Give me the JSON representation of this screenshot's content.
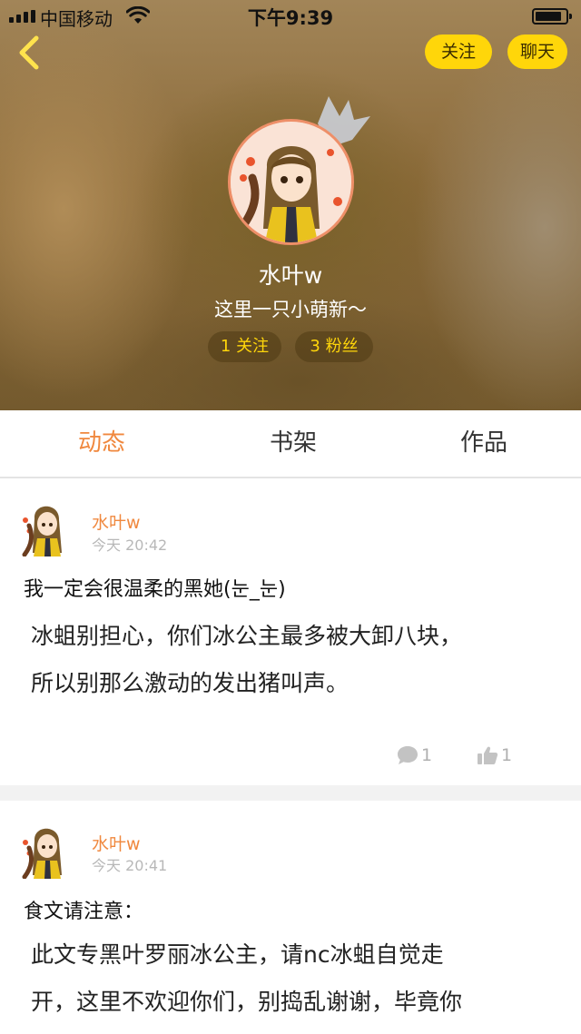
{
  "status_bar": {
    "carrier": "中国移动",
    "time": "下午9:39"
  },
  "header": {
    "follow_label": "关注",
    "chat_label": "聊天",
    "name": "水叶w",
    "bio": "这里一只小萌新～",
    "following_count": "1 关注",
    "fans_count": "3 粉丝"
  },
  "tabs": [
    {
      "label": "动态",
      "active": true
    },
    {
      "label": "书架",
      "active": false
    },
    {
      "label": "作品",
      "active": false
    }
  ],
  "posts": [
    {
      "author": "水叶w",
      "time": "今天 20:42",
      "title": "我一定会很温柔的黑她(눈_눈)",
      "body_lines": [
        "冰蛆别担心，你们冰公主最多被大卸八块，",
        "所以别那么激动的发出猪叫声。"
      ],
      "comments": "1",
      "likes": "1"
    },
    {
      "author": "水叶w",
      "time": "今天 20:41",
      "title": "食文请注意：",
      "body_lines": [
        "此文专黑叶罗丽冰公主，请nc冰蛆自觉走",
        "开，这里不欢迎你们，别捣乱谢谢，毕竟你"
      ]
    }
  ],
  "colors": {
    "accent": "#f0883e",
    "button_yellow": "#ffd60a",
    "muted": "#b8b8b8"
  },
  "icons": {
    "back": "chevron-left-icon",
    "comment": "comment-bubble-icon",
    "like": "thumbs-up-icon",
    "crown": "crown-icon"
  }
}
